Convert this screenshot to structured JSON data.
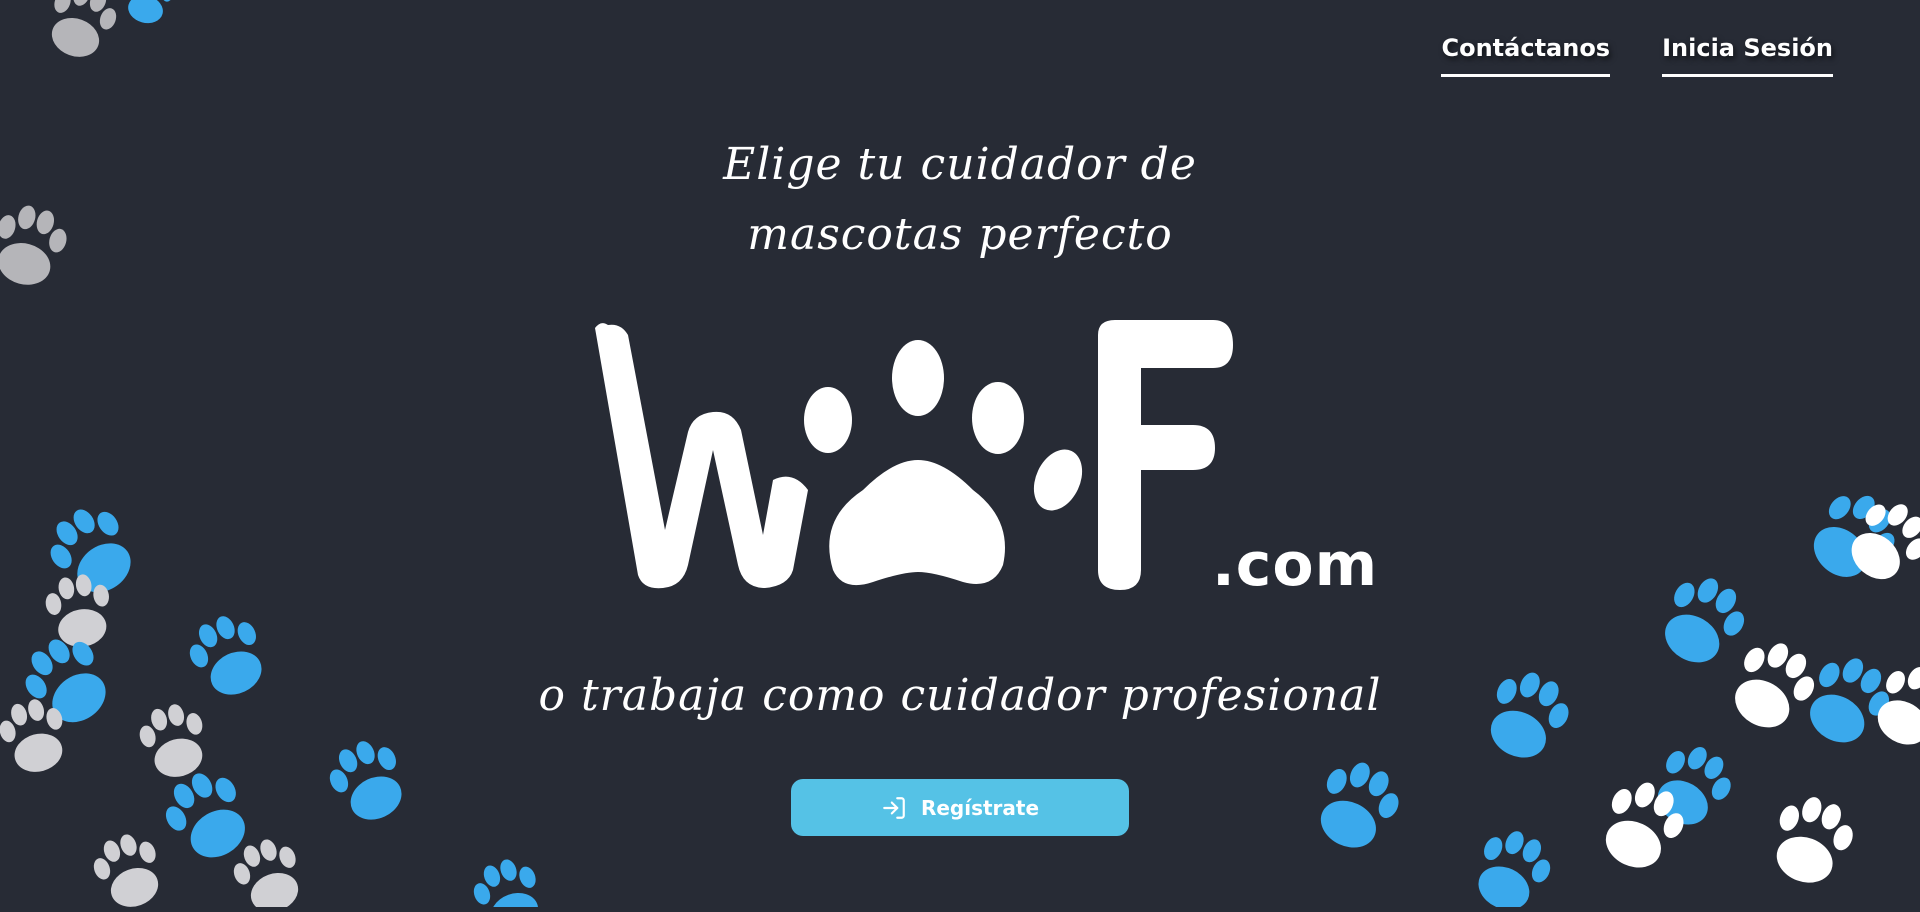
{
  "nav": {
    "contact_label": "Contáctanos",
    "login_label": "Inicia Sesión"
  },
  "hero": {
    "tagline_line1": "Elige tu cuidador de",
    "tagline_line2": "mascotas perfecto",
    "logo_text": "WOOF",
    "logo_suffix": ".com",
    "subtitle": "o trabaja como cuidador profesional"
  },
  "cta": {
    "register_label": "Regístrate",
    "icon": "login-arrow-icon"
  },
  "theme": {
    "background": "#272b35",
    "accent": "#55c2e6",
    "paw_blue": "#3aa9ec",
    "paw_gray": "#c8c8cc",
    "text": "#ffffff"
  }
}
